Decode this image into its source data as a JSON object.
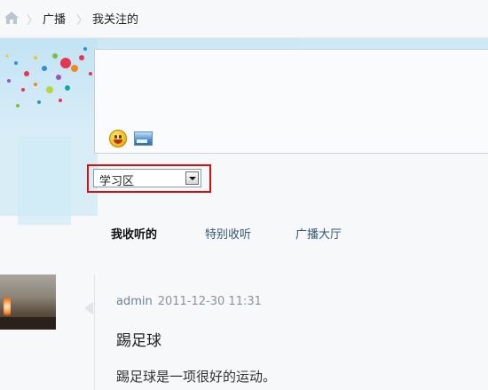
{
  "breadcrumb": {
    "home_icon": "home-icon",
    "items": [
      "广播",
      "我关注的"
    ],
    "separator": "〉"
  },
  "composer": {
    "text": "",
    "emoji_icon": "emoji-icon",
    "image_icon": "image-icon"
  },
  "category_select": {
    "selected": "学习区",
    "arrow_icon": "chevron-down-icon",
    "highlight_color": "#d80e0e"
  },
  "tabs": [
    {
      "label": "我收听的",
      "active": true
    },
    {
      "label": "特别收听",
      "active": false
    },
    {
      "label": "广播大厅",
      "active": false
    }
  ],
  "post": {
    "author": "admin",
    "timestamp": "2011-12-30 11:31",
    "title": "踢足球",
    "body": "踢足球是一项很好的运动。"
  },
  "colors": {
    "link": "#34577a",
    "meta": "#8a939b",
    "border": "#c7d0d8"
  }
}
